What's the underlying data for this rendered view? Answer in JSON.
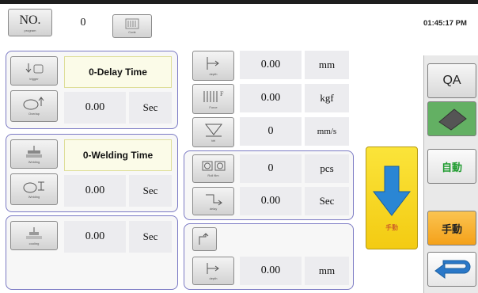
{
  "header": {
    "no_label": "NO.",
    "no_caption": "program",
    "program_value": "0",
    "code_caption": "Code",
    "clock": "01:45:17 PM"
  },
  "left": {
    "trigger_caption": "trigger",
    "delay_title": "0-Delay Time",
    "delay_value": "0.00",
    "delay_unit": "Sec",
    "overlap_caption": "Overlap",
    "weld_caption": "Welding",
    "weld_title": "0-Welding Time",
    "weld_value": "0.00",
    "weld_unit": "Sec",
    "welding_caption": "Welding",
    "cool_caption": "cooling",
    "cool_value": "0.00",
    "cool_unit": "Sec"
  },
  "mid": {
    "depth1_caption": "depth",
    "depth1_value": "0.00",
    "depth1_unit": "mm",
    "force_caption": "Force",
    "force_value": "0.00",
    "force_unit": "kgf",
    "speed_caption": "Vel",
    "speed_value": "0",
    "speed_unit": "mm/s",
    "pcs_caption": "Roll film",
    "pcs_value": "0",
    "pcs_unit": "pcs",
    "delay_caption": "delay",
    "delay_value": "0.00",
    "delay_unit": "Sec",
    "depth2_caption": "depth",
    "depth2_value": "0.00",
    "depth2_unit": "mm"
  },
  "manual_caption": "手動",
  "sidebar": {
    "qa": "QA",
    "auto": "自動",
    "manual": "手動"
  },
  "colors": {
    "frame": "#7b7ac4",
    "cell": "#ececef",
    "title_bg": "#fbfbe8",
    "yellow": "#f7d51c",
    "orange": "#f6a41c",
    "green": "#63b063",
    "auto_text": "#1e9b2e",
    "blue": "#2a78c8"
  }
}
